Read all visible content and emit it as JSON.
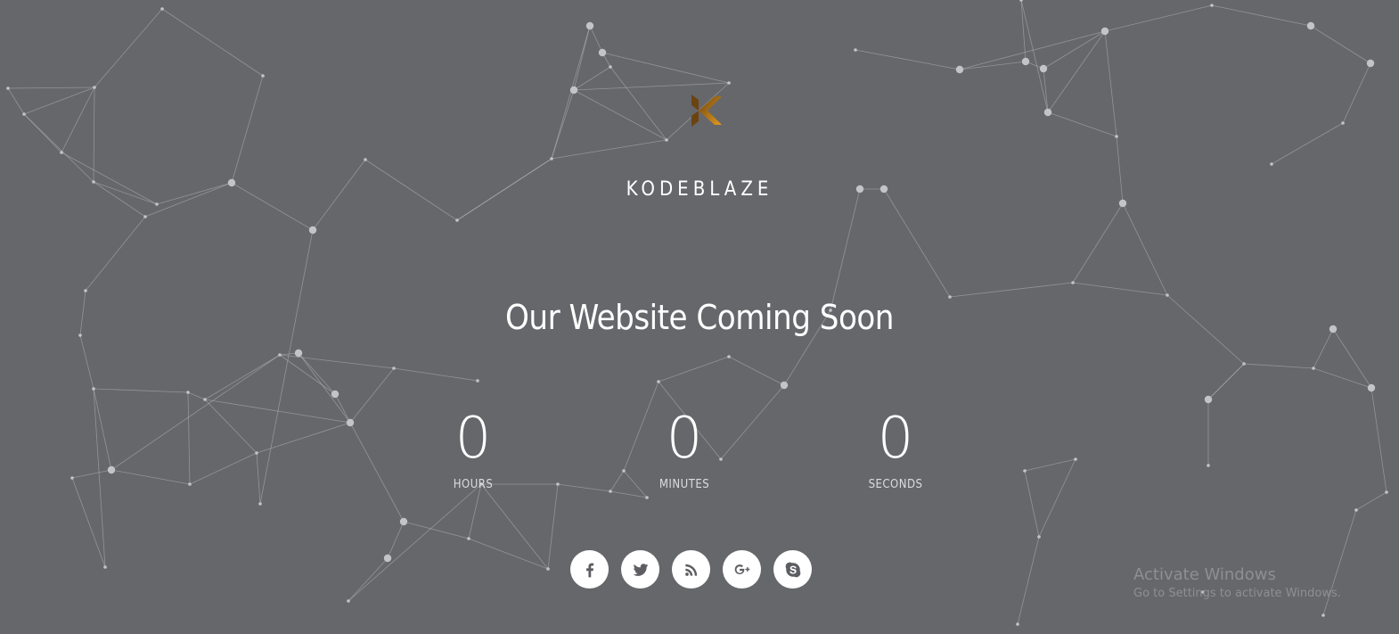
{
  "brand": {
    "name": "KODEBLAZE",
    "logo_icon": "kodeblaze-k-logo-icon",
    "logo_colors": [
      "#7a4e12",
      "#d7951e"
    ]
  },
  "hero": {
    "headline": "Our Website Coming Soon"
  },
  "countdown": [
    {
      "value": "0",
      "label": "HOURS"
    },
    {
      "value": "0",
      "label": "MINUTES"
    },
    {
      "value": "0",
      "label": "SECONDS"
    }
  ],
  "social": [
    {
      "name": "facebook",
      "icon": "facebook-icon"
    },
    {
      "name": "twitter",
      "icon": "twitter-icon"
    },
    {
      "name": "rss",
      "icon": "rss-icon"
    },
    {
      "name": "google-plus",
      "icon": "google-plus-icon"
    },
    {
      "name": "skype",
      "icon": "skype-icon"
    }
  ],
  "os_watermark": {
    "title": "Activate Windows",
    "subtitle": "Go to Settings to activate Windows."
  },
  "colors": {
    "background": "#66676b",
    "text": "#ffffff",
    "network": "#c4c4c7"
  }
}
